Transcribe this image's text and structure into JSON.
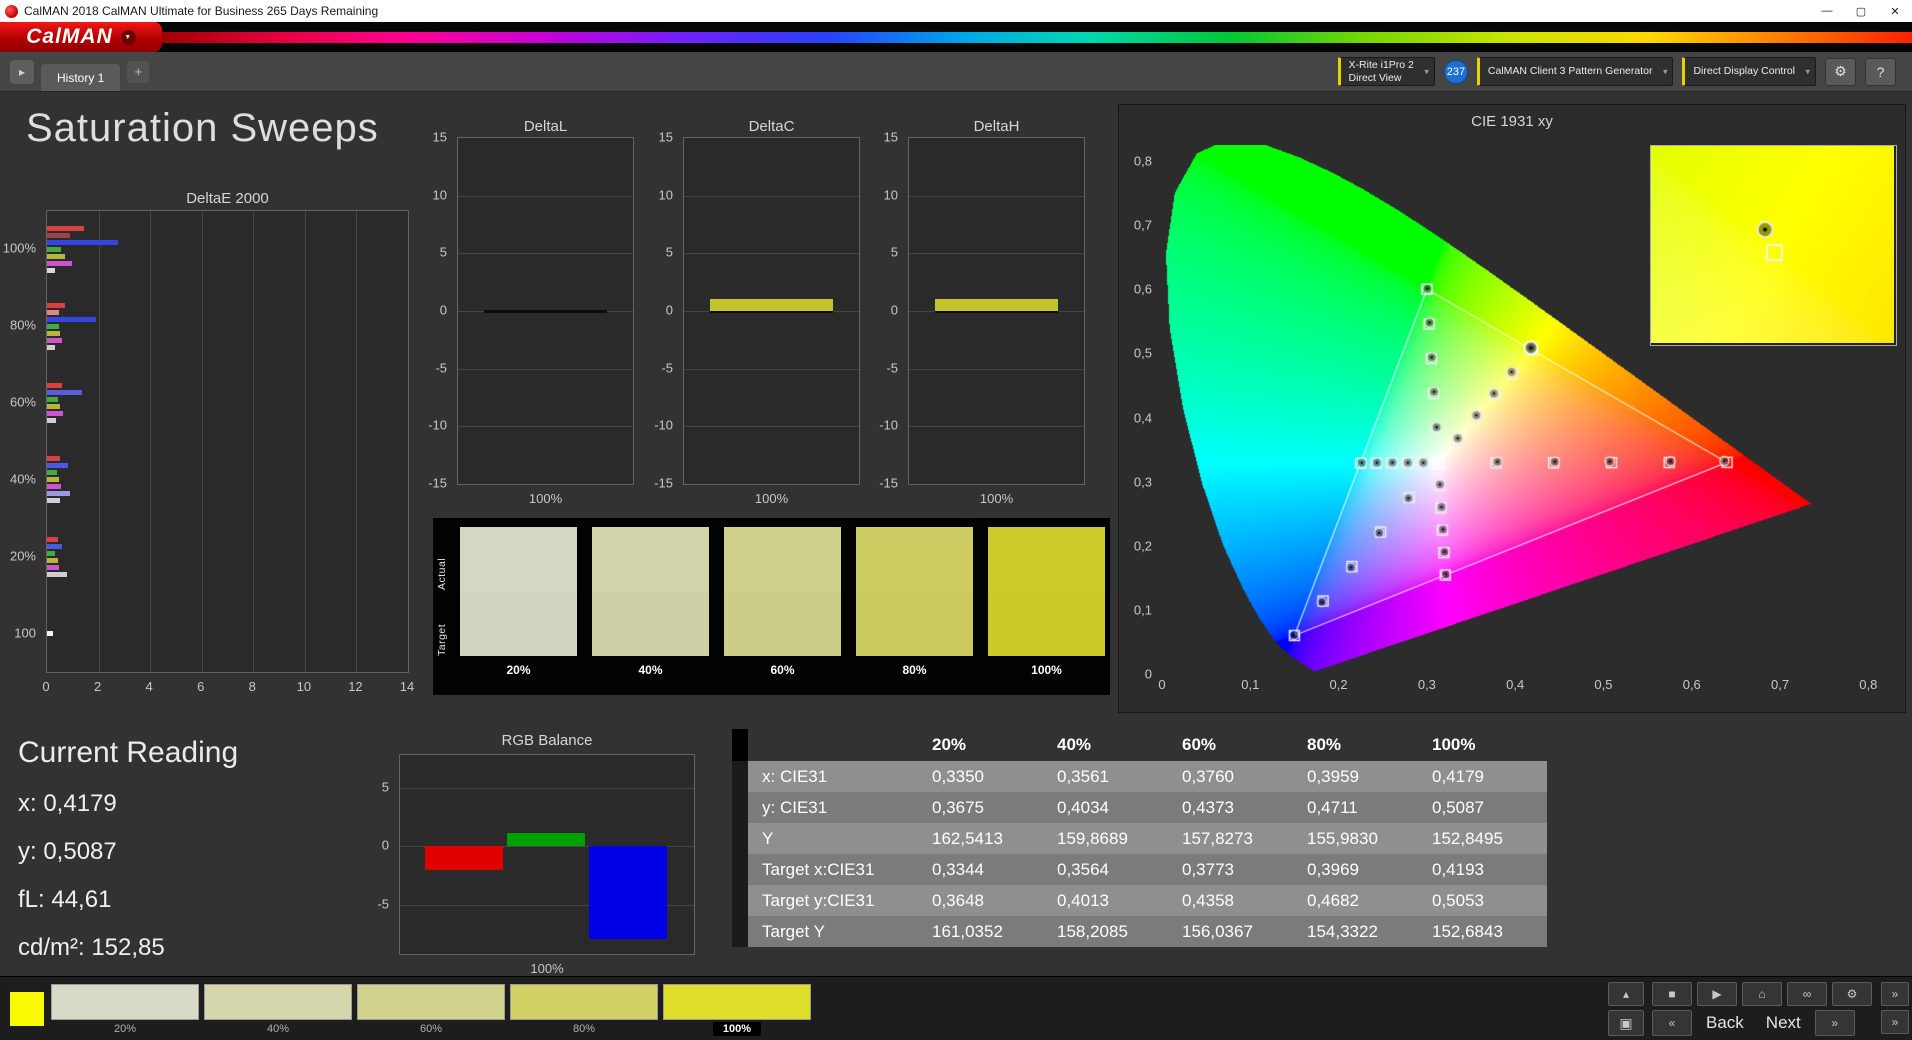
{
  "window": {
    "title": "CalMAN 2018 CalMAN Ultimate for Business 265 Days Remaining",
    "controls": {
      "minimize": "—",
      "maximize": "▢",
      "close": "✕"
    }
  },
  "brand": {
    "logo_text": "CalMAN"
  },
  "tabbar": {
    "history_tab": "History 1",
    "add_tab": "+",
    "meter_device_line1": "X-Rite i1Pro 2",
    "meter_device_line2": "Direct View",
    "meter_badge": "237",
    "pattern_generator": "CalMAN Client 3 Pattern Generator",
    "display_control": "Direct Display Control"
  },
  "page_title": "Saturation Sweeps",
  "swatch_strip": {
    "actual_label": "Actual",
    "target_label": "Target",
    "columns": [
      {
        "label": "20%",
        "actual": "#d6d6c4",
        "target": "#d3d3c1"
      },
      {
        "label": "40%",
        "actual": "#d3d3aa",
        "target": "#d0d0a7"
      },
      {
        "label": "60%",
        "actual": "#d0d08d",
        "target": "#cdcd8a"
      },
      {
        "label": "80%",
        "actual": "#cccc62",
        "target": "#caca60"
      },
      {
        "label": "100%",
        "actual": "#cbcb2c",
        "target": "#c9c92a"
      }
    ]
  },
  "current_reading": {
    "title": "Current Reading",
    "x": "x: 0,4179",
    "y": "y: 0,5087",
    "fl": "fL: 44,61",
    "cdm2": "cd/m²: 152,85"
  },
  "results_table": {
    "col_headers": [
      "20%",
      "40%",
      "60%",
      "80%",
      "100%"
    ],
    "rows": [
      {
        "label": "x: CIE31",
        "values": [
          "0,3350",
          "0,3561",
          "0,3760",
          "0,3959",
          "0,4179"
        ]
      },
      {
        "label": "y: CIE31",
        "values": [
          "0,3675",
          "0,4034",
          "0,4373",
          "0,4711",
          "0,5087"
        ]
      },
      {
        "label": "Y",
        "values": [
          "162,5413",
          "159,8689",
          "157,8273",
          "155,9830",
          "152,8495"
        ]
      },
      {
        "label": "Target x:CIE31",
        "values": [
          "0,3344",
          "0,3564",
          "0,3773",
          "0,3969",
          "0,4193"
        ]
      },
      {
        "label": "Target y:CIE31",
        "values": [
          "0,3648",
          "0,4013",
          "0,4358",
          "0,4682",
          "0,5053"
        ]
      },
      {
        "label": "Target Y",
        "values": [
          "161,0352",
          "158,2085",
          "156,0367",
          "154,3322",
          "152,6843"
        ]
      }
    ]
  },
  "bottom_bar": {
    "pattern_color": "#f9f903",
    "swatches": [
      {
        "label": "20%",
        "color": "#d9d9c7",
        "selected": false
      },
      {
        "label": "40%",
        "color": "#d6d6ad",
        "selected": false
      },
      {
        "label": "60%",
        "color": "#d3d390",
        "selected": false
      },
      {
        "label": "80%",
        "color": "#d0d065",
        "selected": false
      },
      {
        "label": "100%",
        "color": "#dede2b",
        "selected": true
      }
    ],
    "back_label": "Back",
    "next_label": "Next"
  },
  "chart_data": [
    {
      "key": "deltaE",
      "type": "bar",
      "orientation": "horizontal",
      "title": "DeltaE 2000",
      "xlim": [
        0,
        14
      ],
      "xtick_step": 2,
      "groups": [
        {
          "label": "100%",
          "bars": [
            {
              "color": "#d94040",
              "value": 1.45
            },
            {
              "color": "#9c4444",
              "value": 0.9
            },
            {
              "color": "#3346e0",
              "value": 2.75
            },
            {
              "color": "#42aa42",
              "value": 0.55
            },
            {
              "color": "#b6b63c",
              "value": 0.68
            },
            {
              "color": "#cf52cf",
              "value": 0.98
            },
            {
              "color": "#d9d9d9",
              "value": 0.3
            }
          ]
        },
        {
          "label": "80%",
          "bars": [
            {
              "color": "#d94040",
              "value": 0.68
            },
            {
              "color": "#dd8888",
              "value": 0.46
            },
            {
              "color": "#3346e0",
              "value": 1.9
            },
            {
              "color": "#42aa42",
              "value": 0.45
            },
            {
              "color": "#b6b63c",
              "value": 0.52
            },
            {
              "color": "#cf52cf",
              "value": 0.58
            },
            {
              "color": "#cfcfcf",
              "value": 0.3
            }
          ]
        },
        {
          "label": "60%",
          "bars": [
            {
              "color": "#d94040",
              "value": 0.58
            },
            {
              "color": "#5b5bdf",
              "value": 1.35
            },
            {
              "color": "#42aa42",
              "value": 0.42
            },
            {
              "color": "#b6b63c",
              "value": 0.5
            },
            {
              "color": "#cf52cf",
              "value": 0.62
            },
            {
              "color": "#cfcfcf",
              "value": 0.36
            }
          ]
        },
        {
          "label": "40%",
          "bars": [
            {
              "color": "#d94040",
              "value": 0.5
            },
            {
              "color": "#4a5ae0",
              "value": 0.82
            },
            {
              "color": "#42aa42",
              "value": 0.4
            },
            {
              "color": "#b6b63c",
              "value": 0.46
            },
            {
              "color": "#cf52cf",
              "value": 0.55
            },
            {
              "color": "#9a9ade",
              "value": 0.88
            },
            {
              "color": "#cfcfcf",
              "value": 0.5
            }
          ]
        },
        {
          "label": "20%",
          "bars": [
            {
              "color": "#d94040",
              "value": 0.42
            },
            {
              "color": "#4a5ae0",
              "value": 0.58
            },
            {
              "color": "#42aa42",
              "value": 0.32
            },
            {
              "color": "#b6b63c",
              "value": 0.42
            },
            {
              "color": "#cf52cf",
              "value": 0.46
            },
            {
              "color": "#cfcfcf",
              "value": 0.78
            }
          ]
        },
        {
          "label": "100",
          "bars": [
            {
              "color": "#f2f2f2",
              "value": 0.25
            }
          ]
        }
      ]
    },
    {
      "key": "deltaL",
      "type": "bar",
      "title": "DeltaL",
      "ylim": [
        -15,
        15
      ],
      "yticks": [
        15,
        10,
        5,
        0,
        -5,
        -10,
        -15
      ],
      "value": 0,
      "color": "#141414",
      "xlabel": "100%"
    },
    {
      "key": "deltaC",
      "type": "bar",
      "title": "DeltaC",
      "ylim": [
        -15,
        15
      ],
      "yticks": [
        15,
        10,
        5,
        0,
        -5,
        -10,
        -15
      ],
      "value": 1.0,
      "color": "#c3c32e",
      "xlabel": "100%"
    },
    {
      "key": "deltaH",
      "type": "bar",
      "title": "DeltaH",
      "ylim": [
        -15,
        15
      ],
      "yticks": [
        15,
        10,
        5,
        0,
        -5,
        -10,
        -15
      ],
      "value": 1.0,
      "color": "#c3c32e",
      "xlabel": "100%"
    },
    {
      "key": "rgb",
      "type": "bar",
      "title": "RGB Balance",
      "ylim": [
        -9.2,
        7.8
      ],
      "yticks": [
        5,
        0,
        -5
      ],
      "xlabel": "100%",
      "series": [
        {
          "name": "Red",
          "value": -2.0,
          "color": "#e00000"
        },
        {
          "name": "Green",
          "value": 1.1,
          "color": "#00a000"
        },
        {
          "name": "Blue",
          "value": -7.9,
          "color": "#0000e6"
        }
      ]
    },
    {
      "key": "cie",
      "type": "scatter",
      "title": "CIE 1931 xy",
      "xlim": [
        0,
        0.82
      ],
      "ylim": [
        0,
        0.825
      ],
      "tick_values": [
        0,
        0.1,
        0.2,
        0.3,
        0.4,
        0.5,
        0.6,
        0.7,
        0.8
      ],
      "tick_labels": [
        "0",
        "0,1",
        "0,2",
        "0,3",
        "0,4",
        "0,5",
        "0,6",
        "0,7",
        "0,8"
      ],
      "white_point": [
        0.3127,
        0.329
      ],
      "gamut": [
        [
          0.64,
          0.33
        ],
        [
          0.3,
          0.6
        ],
        [
          0.15,
          0.06
        ]
      ],
      "sweeps": [
        {
          "name": "red",
          "targets": [
            [
              0.3782,
              0.3292
            ],
            [
              0.4436,
              0.3294
            ],
            [
              0.5091,
              0.3296
            ],
            [
              0.5745,
              0.3298
            ],
            [
              0.64,
              0.33
            ]
          ],
          "measured": [
            [
              0.38,
              0.331
            ],
            [
              0.445,
              0.3312
            ],
            [
              0.507,
              0.3315
            ],
            [
              0.576,
              0.3318
            ],
            [
              0.637,
              0.3322
            ]
          ]
        },
        {
          "name": "green",
          "targets": [
            [
              0.3102,
              0.3832
            ],
            [
              0.3076,
              0.4374
            ],
            [
              0.3051,
              0.4916
            ],
            [
              0.3025,
              0.5458
            ],
            [
              0.3,
              0.6
            ]
          ],
          "measured": [
            [
              0.311,
              0.385
            ],
            [
              0.3082,
              0.44
            ],
            [
              0.3055,
              0.494
            ],
            [
              0.303,
              0.548
            ],
            [
              0.3006,
              0.601
            ]
          ]
        },
        {
          "name": "blue",
          "targets": [
            [
              0.2802,
              0.2752
            ],
            [
              0.2476,
              0.2214
            ],
            [
              0.2151,
              0.1676
            ],
            [
              0.1825,
              0.1138
            ],
            [
              0.15,
              0.06
            ]
          ],
          "measured": [
            [
              0.279,
              0.274
            ],
            [
              0.246,
              0.22
            ],
            [
              0.214,
              0.166
            ],
            [
              0.181,
              0.112
            ],
            [
              0.1495,
              0.061
            ]
          ]
        },
        {
          "name": "cyan",
          "targets": [
            [
              0.2952,
              0.3289
            ],
            [
              0.2776,
              0.3288
            ],
            [
              0.2601,
              0.3288
            ],
            [
              0.2425,
              0.3287
            ],
            [
              0.225,
              0.3287
            ]
          ],
          "measured": [
            [
              0.296,
              0.3295
            ],
            [
              0.2785,
              0.3296
            ],
            [
              0.261,
              0.3297
            ],
            [
              0.2435,
              0.3295
            ],
            [
              0.2262,
              0.3293
            ]
          ]
        },
        {
          "name": "magenta",
          "targets": [
            [
              0.3143,
              0.2941
            ],
            [
              0.316,
              0.2591
            ],
            [
              0.3176,
              0.2241
            ],
            [
              0.3193,
              0.1892
            ],
            [
              0.3209,
              0.1542
            ]
          ],
          "measured": [
            [
              0.3148,
              0.2955
            ],
            [
              0.3166,
              0.2605
            ],
            [
              0.3183,
              0.2255
            ],
            [
              0.32,
              0.1905
            ],
            [
              0.3215,
              0.1555
            ]
          ]
        },
        {
          "name": "yellow",
          "active": true,
          "targets": [
            [
              0.3344,
              0.3648
            ],
            [
              0.3564,
              0.4013
            ],
            [
              0.3773,
              0.4358
            ],
            [
              0.3969,
              0.4682
            ],
            [
              0.4193,
              0.5053
            ]
          ],
          "measured": [
            [
              0.335,
              0.3675
            ],
            [
              0.3561,
              0.4034
            ],
            [
              0.376,
              0.4373
            ],
            [
              0.3959,
              0.4711
            ],
            [
              0.4179,
              0.5087
            ]
          ]
        }
      ],
      "inset": {
        "x0": 0.401,
        "x1": 0.437,
        "y0": 0.492,
        "y1": 0.521
      }
    }
  ]
}
